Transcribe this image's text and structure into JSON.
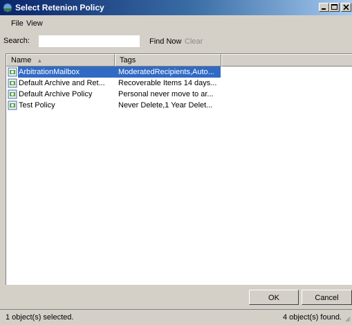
{
  "window": {
    "title": "Select Retenion Policy"
  },
  "menu": {
    "file": "File",
    "view": "View"
  },
  "search": {
    "label": "Search:",
    "value": "",
    "find_now": "Find Now",
    "clear": "Clear"
  },
  "list": {
    "columns": [
      "Name",
      "Tags"
    ],
    "rows": [
      {
        "name": "ArbitrationMailbox",
        "tags": "ModeratedRecipients,Auto...",
        "selected": true
      },
      {
        "name": "Default Archive and Ret...",
        "tags": "Recoverable Items 14 days..."
      },
      {
        "name": "Default Archive Policy",
        "tags": "Personal never move to ar..."
      },
      {
        "name": "Test Policy",
        "tags": "Never Delete,1 Year Delet..."
      }
    ]
  },
  "buttons": {
    "ok": "OK",
    "cancel": "Cancel"
  },
  "status": {
    "left": "1 object(s) selected.",
    "right": "4 object(s) found."
  },
  "colors": {
    "selection": "#316ac5",
    "titlebar": "#0a246a",
    "dialog_bg": "#d4d0c8"
  }
}
